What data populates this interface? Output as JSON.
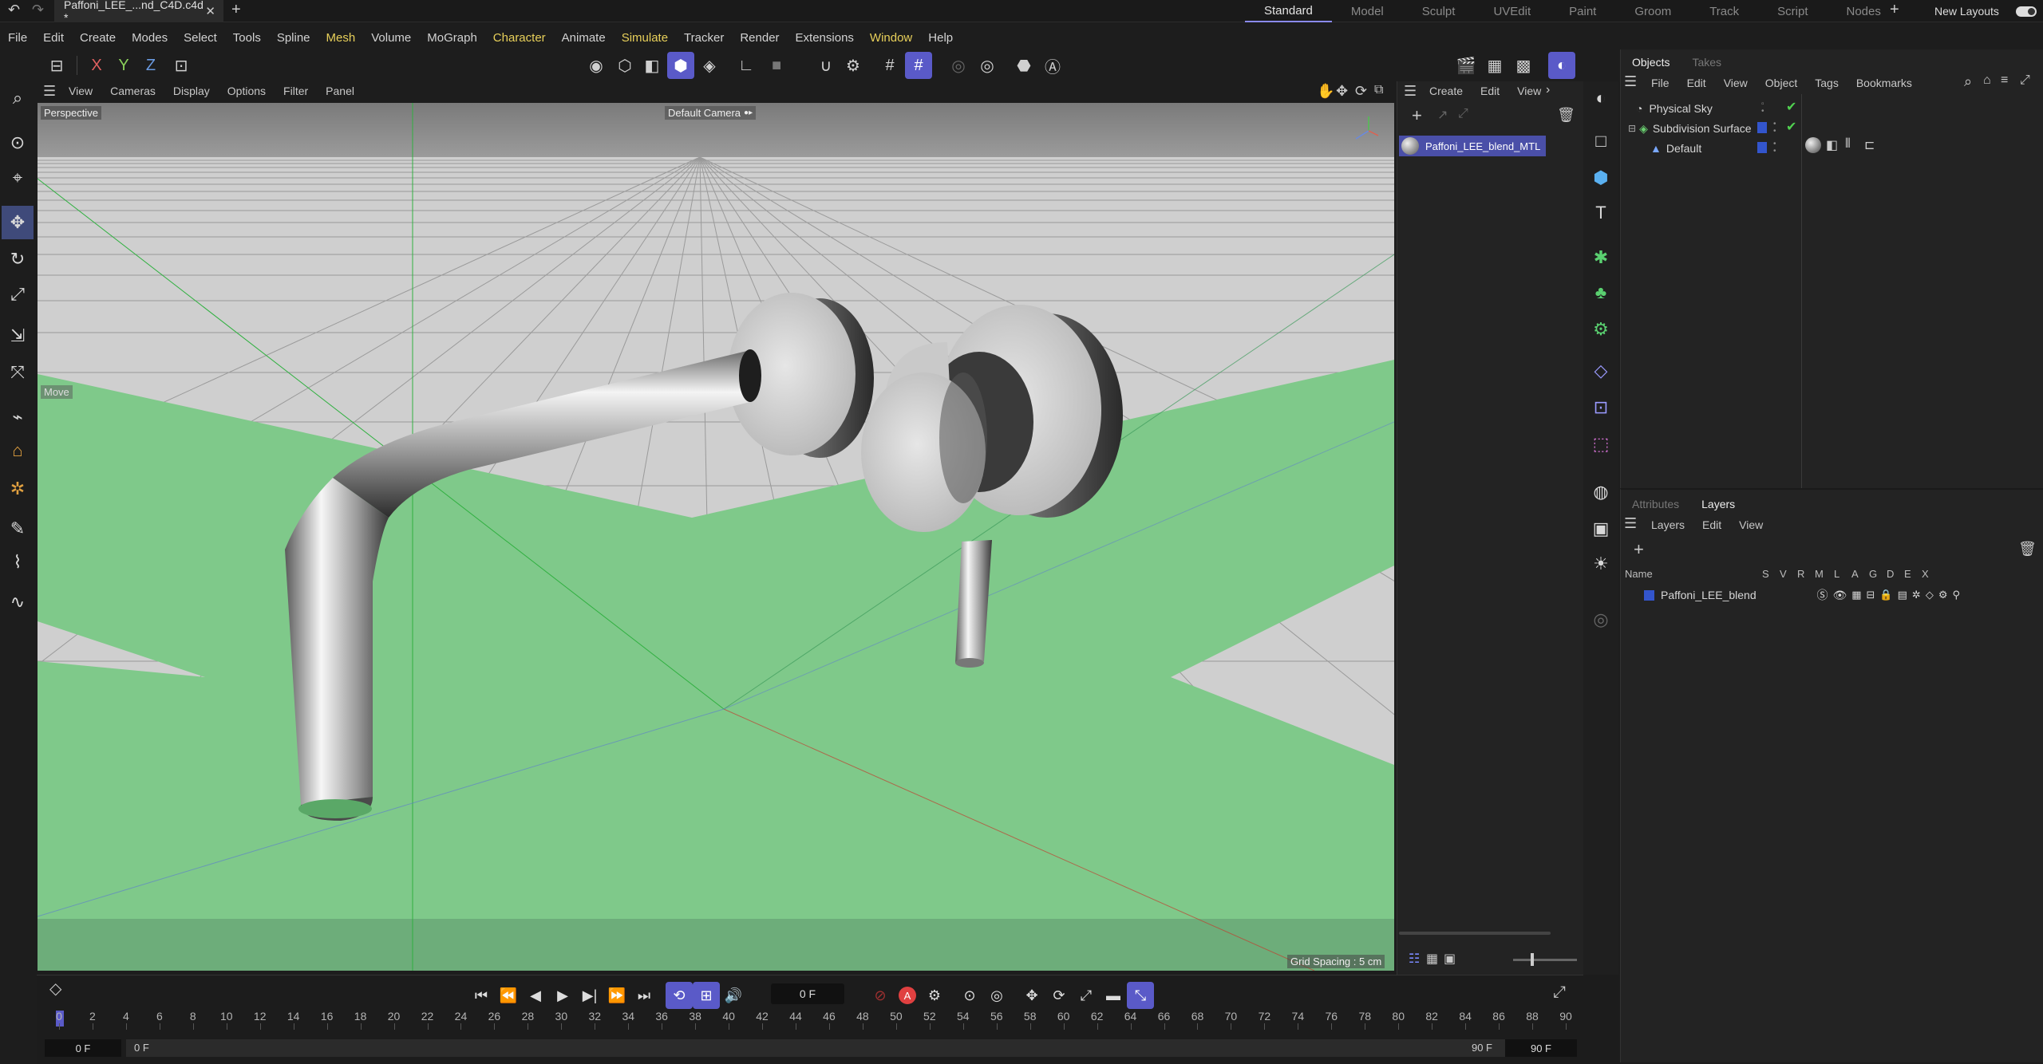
{
  "window": {
    "doc_tab": "Paffoni_LEE_...nd_C4D.c4d *",
    "layouts": [
      "Standard",
      "Model",
      "Sculpt",
      "UVEdit",
      "Paint",
      "Groom",
      "Track",
      "Script",
      "Nodes"
    ],
    "active_layout": "Standard",
    "new_layouts": "New Layouts"
  },
  "menubar": [
    "File",
    "Edit",
    "Create",
    "Modes",
    "Select",
    "Tools",
    "Spline",
    "Mesh",
    "Volume",
    "MoGraph",
    "Character",
    "Animate",
    "Simulate",
    "Tracker",
    "Render",
    "Extensions",
    "Window",
    "Help"
  ],
  "highlighted_menus": [
    "Mesh",
    "Character",
    "Simulate",
    "Window"
  ],
  "axis_toolbar": {
    "x": "X",
    "y": "Y",
    "z": "Z"
  },
  "viewport": {
    "menu": [
      "View",
      "Cameras",
      "Display",
      "Options",
      "Filter",
      "Panel"
    ],
    "projection": "Perspective",
    "camera": "Default Camera",
    "tool_hint": "Move",
    "grid_spacing": "Grid Spacing : 5 cm"
  },
  "material_manager": {
    "menu": [
      "Create",
      "Edit",
      "View"
    ],
    "material": "Paffoni_LEE_blend_MTL"
  },
  "objects_panel": {
    "tabs": [
      "Objects",
      "Takes"
    ],
    "active_tab": "Objects",
    "menu": [
      "File",
      "Edit",
      "View",
      "Object",
      "Tags",
      "Bookmarks"
    ],
    "items": [
      {
        "name": "Physical Sky",
        "indent": 0
      },
      {
        "name": "Subdivision Surface",
        "indent": 0
      },
      {
        "name": "Default",
        "indent": 1
      }
    ]
  },
  "layers_panel": {
    "tabs": [
      "Attributes",
      "Layers"
    ],
    "active_tab": "Layers",
    "menu": [
      "Layers",
      "Edit",
      "View"
    ],
    "columns": [
      "Name",
      "S",
      "V",
      "R",
      "M",
      "L",
      "A",
      "G",
      "D",
      "E",
      "X"
    ],
    "layers": [
      {
        "name": "Paffoni_LEE_blend",
        "color": "#3355cc"
      }
    ]
  },
  "timeline": {
    "current_frame": "0 F",
    "start_frame": "0 F",
    "range_start": "0 F",
    "range_end": "90 F",
    "end_frame": "90 F",
    "ticks": [
      "0",
      "2",
      "4",
      "6",
      "8",
      "10",
      "12",
      "14",
      "16",
      "18",
      "20",
      "22",
      "24",
      "26",
      "28",
      "30",
      "32",
      "34",
      "36",
      "38",
      "40",
      "42",
      "44",
      "46",
      "48",
      "50",
      "52",
      "54",
      "56",
      "58",
      "60",
      "62",
      "64",
      "66",
      "68",
      "70",
      "72",
      "74",
      "76",
      "78",
      "80",
      "82",
      "84",
      "86",
      "88",
      "90"
    ]
  },
  "colors": {
    "accent": "#5a5ac8",
    "floor": "#7fc98a",
    "background": "#1d1d1d",
    "highlight_menu": "#e8d05a"
  }
}
